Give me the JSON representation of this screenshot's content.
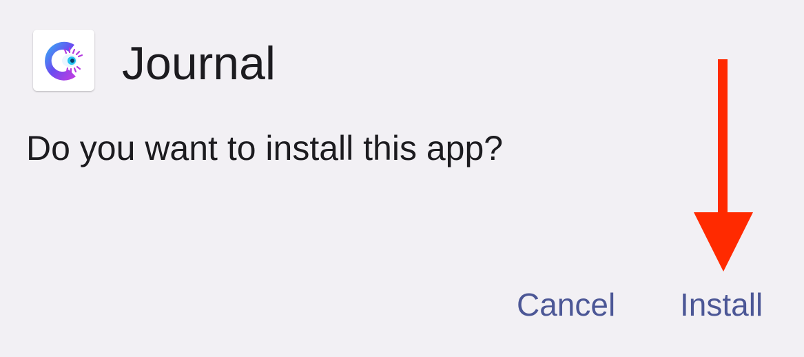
{
  "dialog": {
    "app_icon": "journal-app-icon",
    "app_name": "Journal",
    "question": "Do you want to install this app?",
    "buttons": {
      "cancel_label": "Cancel",
      "install_label": "Install"
    }
  },
  "annotation": {
    "arrow_icon": "arrow-down-icon",
    "arrow_color": "#ff2a00"
  },
  "colors": {
    "background": "#f2f0f4",
    "text": "#1c1b1f",
    "accent": "#4c5796"
  }
}
